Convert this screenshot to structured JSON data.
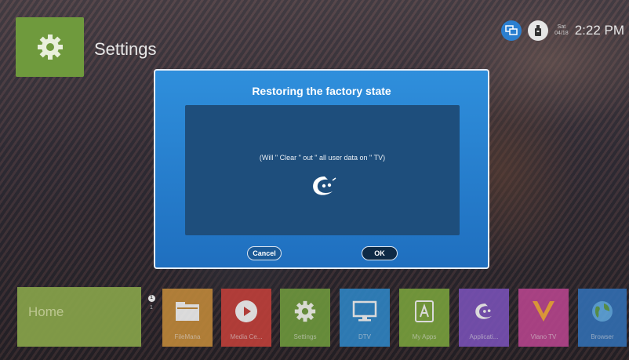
{
  "header": {
    "title": "Settings",
    "date_line1": "Sat",
    "date_line2": "04/18",
    "time": "2:22 PM",
    "icons": [
      "gear-icon",
      "network-icon",
      "usb-icon"
    ]
  },
  "dialog": {
    "title": "Restoring the factory state",
    "message": "(Will \" Clear \" out \" all user data on \" TV)",
    "cancel_label": "Cancel",
    "ok_label": "OK"
  },
  "dock": {
    "home_label": "Home",
    "page_indicator": "1",
    "page_number": "1",
    "apps": [
      {
        "label": "FileMana",
        "color": "#c28a3a",
        "icon": "folder-icon"
      },
      {
        "label": "Media Ce...",
        "color": "#c2403a",
        "icon": "play-icon"
      },
      {
        "label": "Settings",
        "color": "#6f9a3d",
        "icon": "gear-icon"
      },
      {
        "label": "DTV",
        "color": "#2f86c6",
        "icon": "monitor-icon"
      },
      {
        "label": "My Apps",
        "color": "#7aa33d",
        "icon": "apps-icon"
      },
      {
        "label": "Applicati...",
        "color": "#7a52b8",
        "icon": "logo-icon"
      },
      {
        "label": "Vlano TV",
        "color": "#b8458e",
        "icon": "vtv-icon"
      },
      {
        "label": "Browser",
        "color": "#3270b5",
        "icon": "globe-icon"
      }
    ]
  },
  "colors": {
    "dialog_accent": "#2f8fdc",
    "dialog_body": "#1e4e7c",
    "settings_tile": "#6f9a3d"
  }
}
